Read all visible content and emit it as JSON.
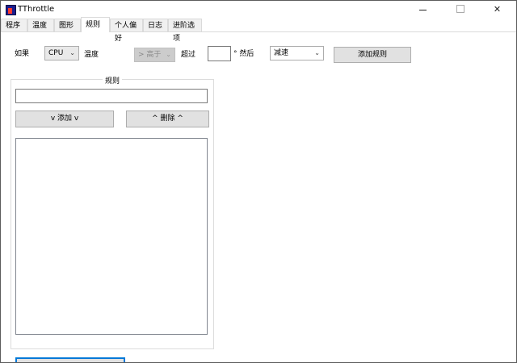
{
  "window": {
    "title": "TThrottle",
    "min_glyph": "",
    "max_glyph": "",
    "close_glyph": "✕"
  },
  "tabs": [
    {
      "label": "程序",
      "active": false
    },
    {
      "label": "温度",
      "active": false
    },
    {
      "label": "图形",
      "active": false
    },
    {
      "label": "规则",
      "active": true
    },
    {
      "label": "个人偏好",
      "active": false
    },
    {
      "label": "日志",
      "active": false
    },
    {
      "label": "进阶选项",
      "active": false
    }
  ],
  "rule_builder": {
    "if_label": "如果",
    "source_value": "CPU",
    "temperature_label": "温度",
    "comparison_value": "> 高于",
    "exceeds_label": "超过",
    "threshold_value": "",
    "then_label": "° 然后",
    "action_value": "减速",
    "add_rule_label": "添加规则"
  },
  "rules_group": {
    "title": "规则",
    "rule_text_value": "",
    "add_label": "v 添加 v",
    "delete_label": "^ 删除 ^",
    "rules_list": []
  },
  "icons": {
    "app": "tthrottle-app-icon",
    "dropdown": "chevron-down-icon"
  }
}
